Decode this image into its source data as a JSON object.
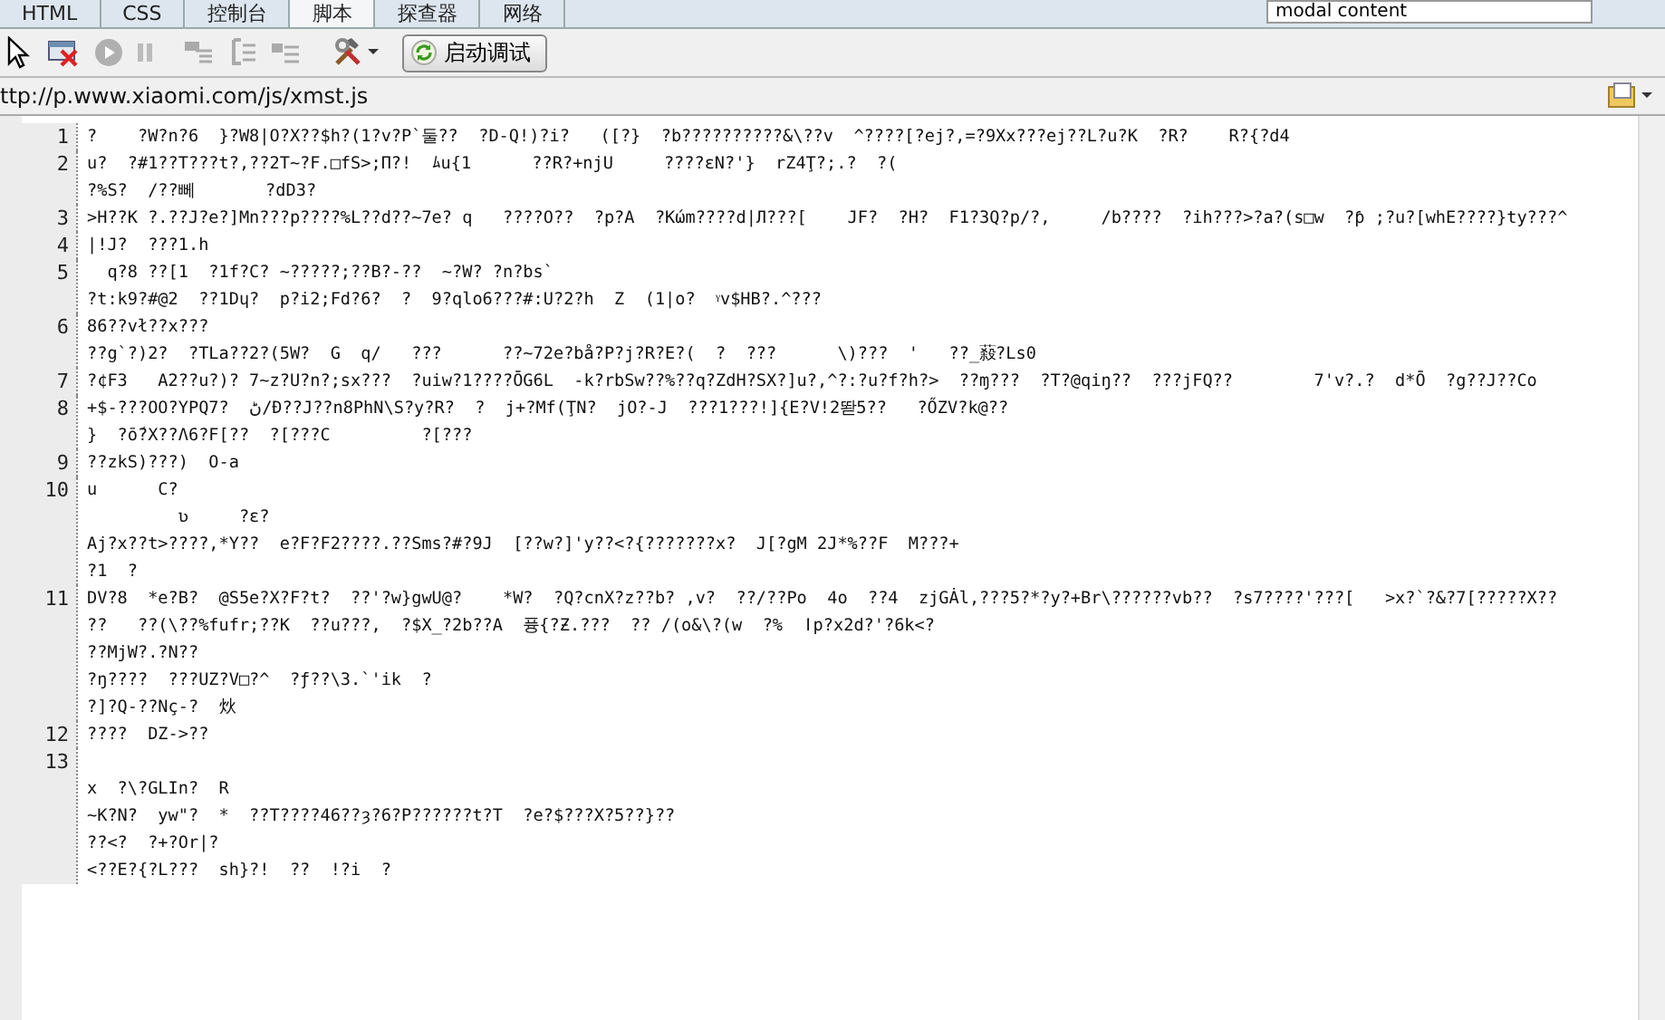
{
  "tabs": [
    {
      "label": "HTML",
      "selected": false
    },
    {
      "label": "CSS",
      "selected": false
    },
    {
      "label": "控制台",
      "selected": false
    },
    {
      "label": "脚本",
      "selected": true
    },
    {
      "label": "探查器",
      "selected": false
    },
    {
      "label": "网络",
      "selected": false
    }
  ],
  "search": {
    "value": "modal content"
  },
  "toolbar": {
    "debug_button": "启动调试"
  },
  "file_path": "ttp://p.www.xiaomi.com/js/xmst.js",
  "source_lines": [
    {
      "number": "1",
      "leading_blank": false,
      "rows": [
        "?    ?W?n?6  }?W8|O?X??$h?(1?v?P`둘??  ?D-Q!)?i?   ([?}  ?b??????????&\\??v  ^????[?ej?,=?9Xx???ej??L?u?K  ?R?    R?{?d4"
      ]
    },
    {
      "number": "2",
      "leading_blank": false,
      "rows": [
        "u?  ?#1??T???t?,??2T~?F.□fS>;Π?!  ﾑu{1      ??R?+njU     ????ɛN?'}  rZ4Ţ?;.?  ?(",
        "?%S?  /??뻬       ?dD3?"
      ]
    },
    {
      "number": "3",
      "leading_blank": false,
      "rows": [
        ">H??K ?.??J?e?]Mn???p????%L??d??~7e? q   ????O??  ?p?A  ?Kώm????d|Л???[    JF?  ?H?  F1?3Q?p/?,     /b????  ?ih???>?a?(s□w  ?ƥ ;?u?[whE????}ty???^"
      ]
    },
    {
      "number": "4",
      "leading_blank": false,
      "rows": [
        "|!J?  ???1.h"
      ]
    },
    {
      "number": "5",
      "leading_blank": false,
      "rows": [
        "  q?8 ??[1  ?1f?C? ~?????;??B?-??  ~?W? ?n?bs`",
        "?t:k9?#@2  ??1Dɥ?  p?i2;Fd?6?  ?  9?qlo6???#:U?2?h  Z  (1|o?  ᵞv$HB?.^???"
      ]
    },
    {
      "number": "6",
      "leading_blank": false,
      "rows": [
        "86??vł??x???",
        "??g`?)2?  ?TLa??2?(5W?  G  q/   ???      ??~72e?bå?P?j?R?E?(  ?  ???      \\)???  '   ??_蔱?Ls0"
      ]
    },
    {
      "number": "7",
      "leading_blank": false,
      "rows": [
        "?¢F3   A2??u?)? 7~z?U?n?;sx???  ?uiw?1????ŌG6L  -k?rbSw??%??q?ZdH?SX?]u?,^?:?u?f?h?>  ??ɱ???  ?T?@qiŋ??  ???jFQ??        7'v?.?  d*Ō  ?g??J??Co"
      ]
    },
    {
      "number": "8",
      "leading_blank": false,
      "rows": [
        "+$-???OO?YPQڻ  ?7/Ɖ??J??n8PhN\\S?y?R?  ?  j+?Mf(ŢN?  jO?-J  ???1???!]{E?V!2똳5??   ?ŐZV?k@??",
        "}  ?ṓ?X??Λ6?F[??  ?[???C         ?[???"
      ]
    },
    {
      "number": "9",
      "leading_blank": false,
      "rows": [
        "??zkS)???)  O-a"
      ]
    },
    {
      "number": "10",
      "leading_blank": false,
      "rows": [
        "u      C?",
        "         ʋ     ?ɛ?",
        "Aj?x??t>????,*Y??  e?F?F2????.??Sms?#?9J  [??w?]'y??<?{???????x?  J[?gM 2J*%??F  M???+",
        "?1  ?"
      ]
    },
    {
      "number": "11",
      "leading_blank": false,
      "rows": [
        "DV?8  *e?B?  @S5e?X?F?t?  ??'?w}gwU@?    *W?  ?Q?cnX?z??b? ,v?  ??/??Po  4o  ??4  zjGȦl,???5?*?y?+Br\\??????vb??  ?s7????'???[   >x?`?&?7[?????X??",
        "??   ??(\\??%fufr;??K  ??u???,  ?$X_?2b??A  퓽{?Ƶ.???  ?? /(o&\\?(w  ?%  ǀp?x2d?'?6k<?",
        "??MjW?.?N??",
        "?ŋ????  ???UZ?V□?^  ?ƒ??\\3.`'ik  ?",
        "?]?Q-??Nç-?  炏"
      ]
    },
    {
      "number": "12",
      "leading_blank": false,
      "rows": [
        "????  DZ->??"
      ]
    },
    {
      "number": "13",
      "leading_blank": true,
      "rows": [
        "x  ?\\?GLIn?  R",
        "~K?N?  yw\"?  *  ??T????46??ȝ?6?P??????t?T  ?e?$???X?5??}??",
        "??<?  ?+?Or|?",
        "<??E?{?L???  sh}?!  ??  !?i  ?"
      ]
    }
  ]
}
